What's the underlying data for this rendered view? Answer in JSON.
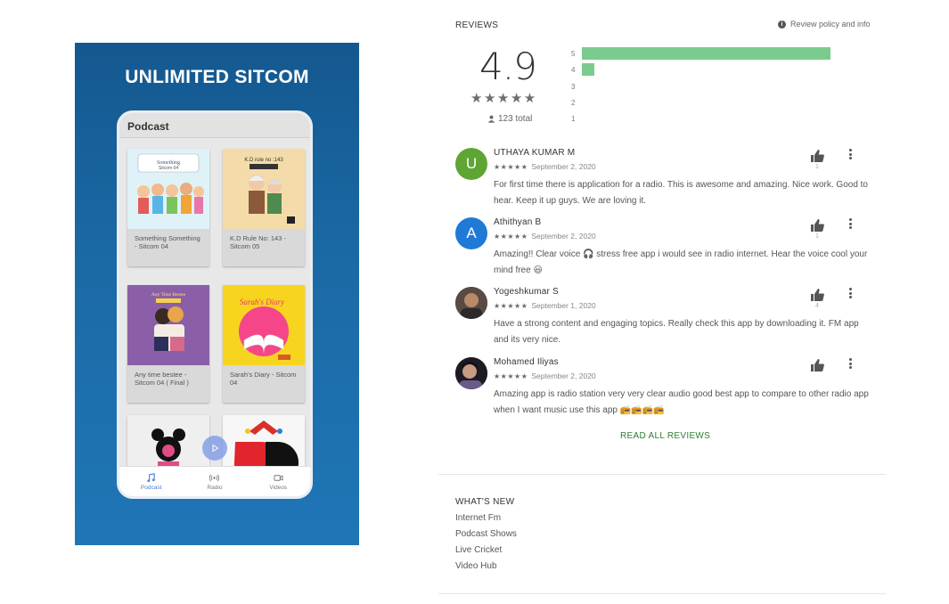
{
  "promo": {
    "title": "UNLIMITED SITCOM",
    "screen_title": "Podcast",
    "cards": [
      {
        "caption": "Something Something - Sitcom 04",
        "thumb_text": "Sitcom 04",
        "bg": "#dff2f7"
      },
      {
        "caption": "K.D Rule No: 143 - Sitcom 05",
        "thumb_text": "K.D rule no :143",
        "bg": "#f3dca9"
      },
      {
        "caption": "Any time bestee - Sitcom 04 ( Final )",
        "thumb_text": "Any Time Bestee",
        "bg": "#8a5fa8"
      },
      {
        "caption": "Sarah's Diary - Sitcom 04",
        "thumb_text": "Sarah's Diary",
        "bg": "#f7d51e"
      },
      {
        "caption": "",
        "thumb_text": "",
        "bg": "#f2f2f2"
      },
      {
        "caption": "",
        "thumb_text": "",
        "bg": "#f7f7f7"
      }
    ],
    "nav": [
      {
        "label": "Podcast",
        "icon": "music-note-icon",
        "active": true
      },
      {
        "label": "Radio",
        "icon": "radio-broadcast-icon",
        "active": false
      },
      {
        "label": "Videos",
        "icon": "video-camera-icon",
        "active": false
      }
    ]
  },
  "reviews": {
    "heading": "REVIEWS",
    "policy_link": "Review policy and info",
    "rating": "4.9",
    "stars": "★★★★★",
    "total": "123 total",
    "histogram": [
      {
        "label": "5",
        "fraction": 0.97
      },
      {
        "label": "4",
        "fraction": 0.05
      },
      {
        "label": "3",
        "fraction": 0
      },
      {
        "label": "2",
        "fraction": 0
      },
      {
        "label": "1",
        "fraction": 0
      }
    ],
    "bar_color": "#7acb8e",
    "items": [
      {
        "name": "UTHAYA KUMAR M",
        "stars": "★★★★★",
        "date": "September 2, 2020",
        "text": "For first time there is application for a radio. This is awesome and amazing. Nice work. Good to hear. Keep it up guys. We are loving it.",
        "likes": "1",
        "avatar_letter": "U",
        "avatar_color": "#5fa533"
      },
      {
        "name": "Athithyan B",
        "stars": "★★★★★",
        "date": "September 2, 2020",
        "text": "Amazing!! Clear voice 🎧 stress free app i would see in radio internet. Hear the voice cool your mind free 😃",
        "likes": "1",
        "avatar_letter": "A",
        "avatar_color": "#1f7ad6"
      },
      {
        "name": "Yogeshkumar S",
        "stars": "★★★★★",
        "date": "September 1, 2020",
        "text": "Have a strong content and engaging topics. Really check this app by downloading it. FM app and its very nice.",
        "likes": "4",
        "avatar_letter": "",
        "avatar_color": "#4a3a34"
      },
      {
        "name": "Mohamed Iliyas",
        "stars": "★★★★★",
        "date": "September 2, 2020",
        "text": "Amazing app is radio station very very clear audio good best app to compare to other radio app when I want music use this app 📻📻📻📻",
        "likes": "",
        "avatar_letter": "",
        "avatar_color": "#2a2230"
      }
    ],
    "read_all": "READ ALL REVIEWS"
  },
  "whats_new": {
    "heading": "WHAT'S NEW",
    "items": [
      "Internet Fm",
      "Podcast Shows",
      "Live Cricket",
      "Video Hub"
    ]
  }
}
